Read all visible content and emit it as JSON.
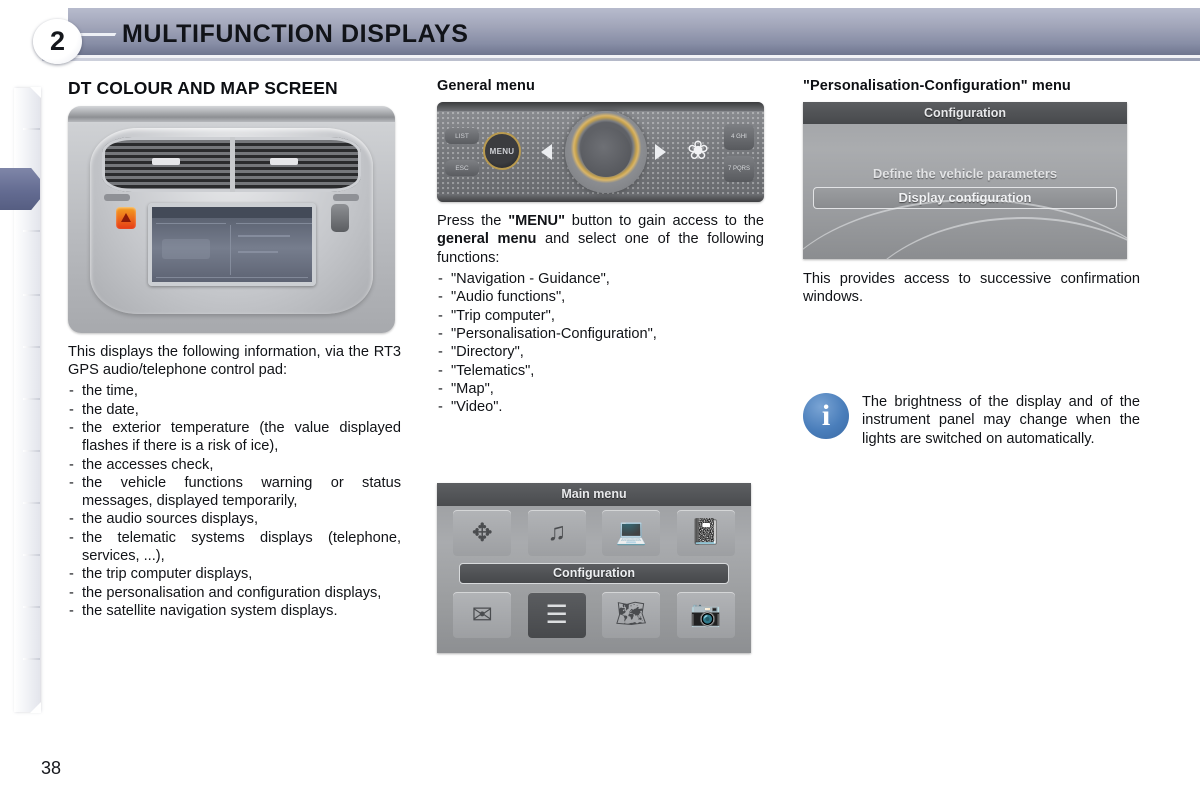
{
  "header": {
    "chapter_number": "2",
    "title": "MULTIFUNCTION DISPLAYS"
  },
  "page_number": "38",
  "left_column": {
    "heading": "DT COLOUR AND MAP SCREEN",
    "photo_caption_name": "dashboard-multifunction-display-photo",
    "intro": "This displays the following information, via the RT3 GPS audio/telephone control pad:",
    "items": [
      "the time,",
      "the date,",
      "the exterior temperature (the value displayed flashes if there is a risk of ice),",
      "the accesses check,",
      "the vehicle functions warning or status messages, displayed temporarily,",
      "the audio sources displays,",
      "the telematic systems displays (telephone, services, ...),",
      "the trip computer displays,",
      "the personalisation and configuration displays,",
      "the satellite navigation system displays."
    ]
  },
  "middle_column": {
    "heading": "General menu",
    "control_pad": {
      "menu_button_label": "MENU",
      "left_button_top_label": "LIST",
      "left_button_bottom_label": "ESC",
      "right_button_top_label": "4\nGHI",
      "right_button_bottom_label": "7\nPQRS",
      "brand_icon": "lion-emblem-icon"
    },
    "paragraph_pre": "Press the ",
    "paragraph_bold1": "\"MENU\"",
    "paragraph_mid": " button to gain access to the ",
    "paragraph_bold2": "general menu",
    "paragraph_post": " and select one of the following functions:",
    "functions": [
      "\"Navigation - Guidance\",",
      "\"Audio functions\",",
      "\"Trip computer\",",
      "\"Personalisation-Configuration\",",
      "\"Directory\",",
      "\"Telematics\",",
      "\"Map\",",
      "\"Video\"."
    ],
    "main_menu_screen": {
      "title": "Main menu",
      "icons_row1": [
        "navigation-guidance-icon",
        "audio-functions-icon",
        "trip-computer-icon",
        "directory-icon"
      ],
      "icons_row2": [
        "telematics-icon",
        "configuration-icon",
        "map-icon",
        "video-icon"
      ],
      "selected_label": "Configuration",
      "selected_index": 1
    }
  },
  "right_column": {
    "heading": "\"Personalisation-Configuration\" menu",
    "configuration_screen": {
      "title": "Configuration",
      "line1": "Define the vehicle parameters",
      "selected_item": "Display configuration"
    },
    "paragraph": "This provides access to successive confirmation windows.",
    "info_note": {
      "icon": "info-icon",
      "text": "The brightness of the display and of the instrument panel may change when the lights are switched on automatically."
    }
  },
  "colors": {
    "header_gradient_light": "#b7bbcd",
    "header_gradient_dark": "#6f768f",
    "active_tab": "#646c92",
    "info_icon_blue": "#4a7ebb",
    "text": "#111317"
  }
}
